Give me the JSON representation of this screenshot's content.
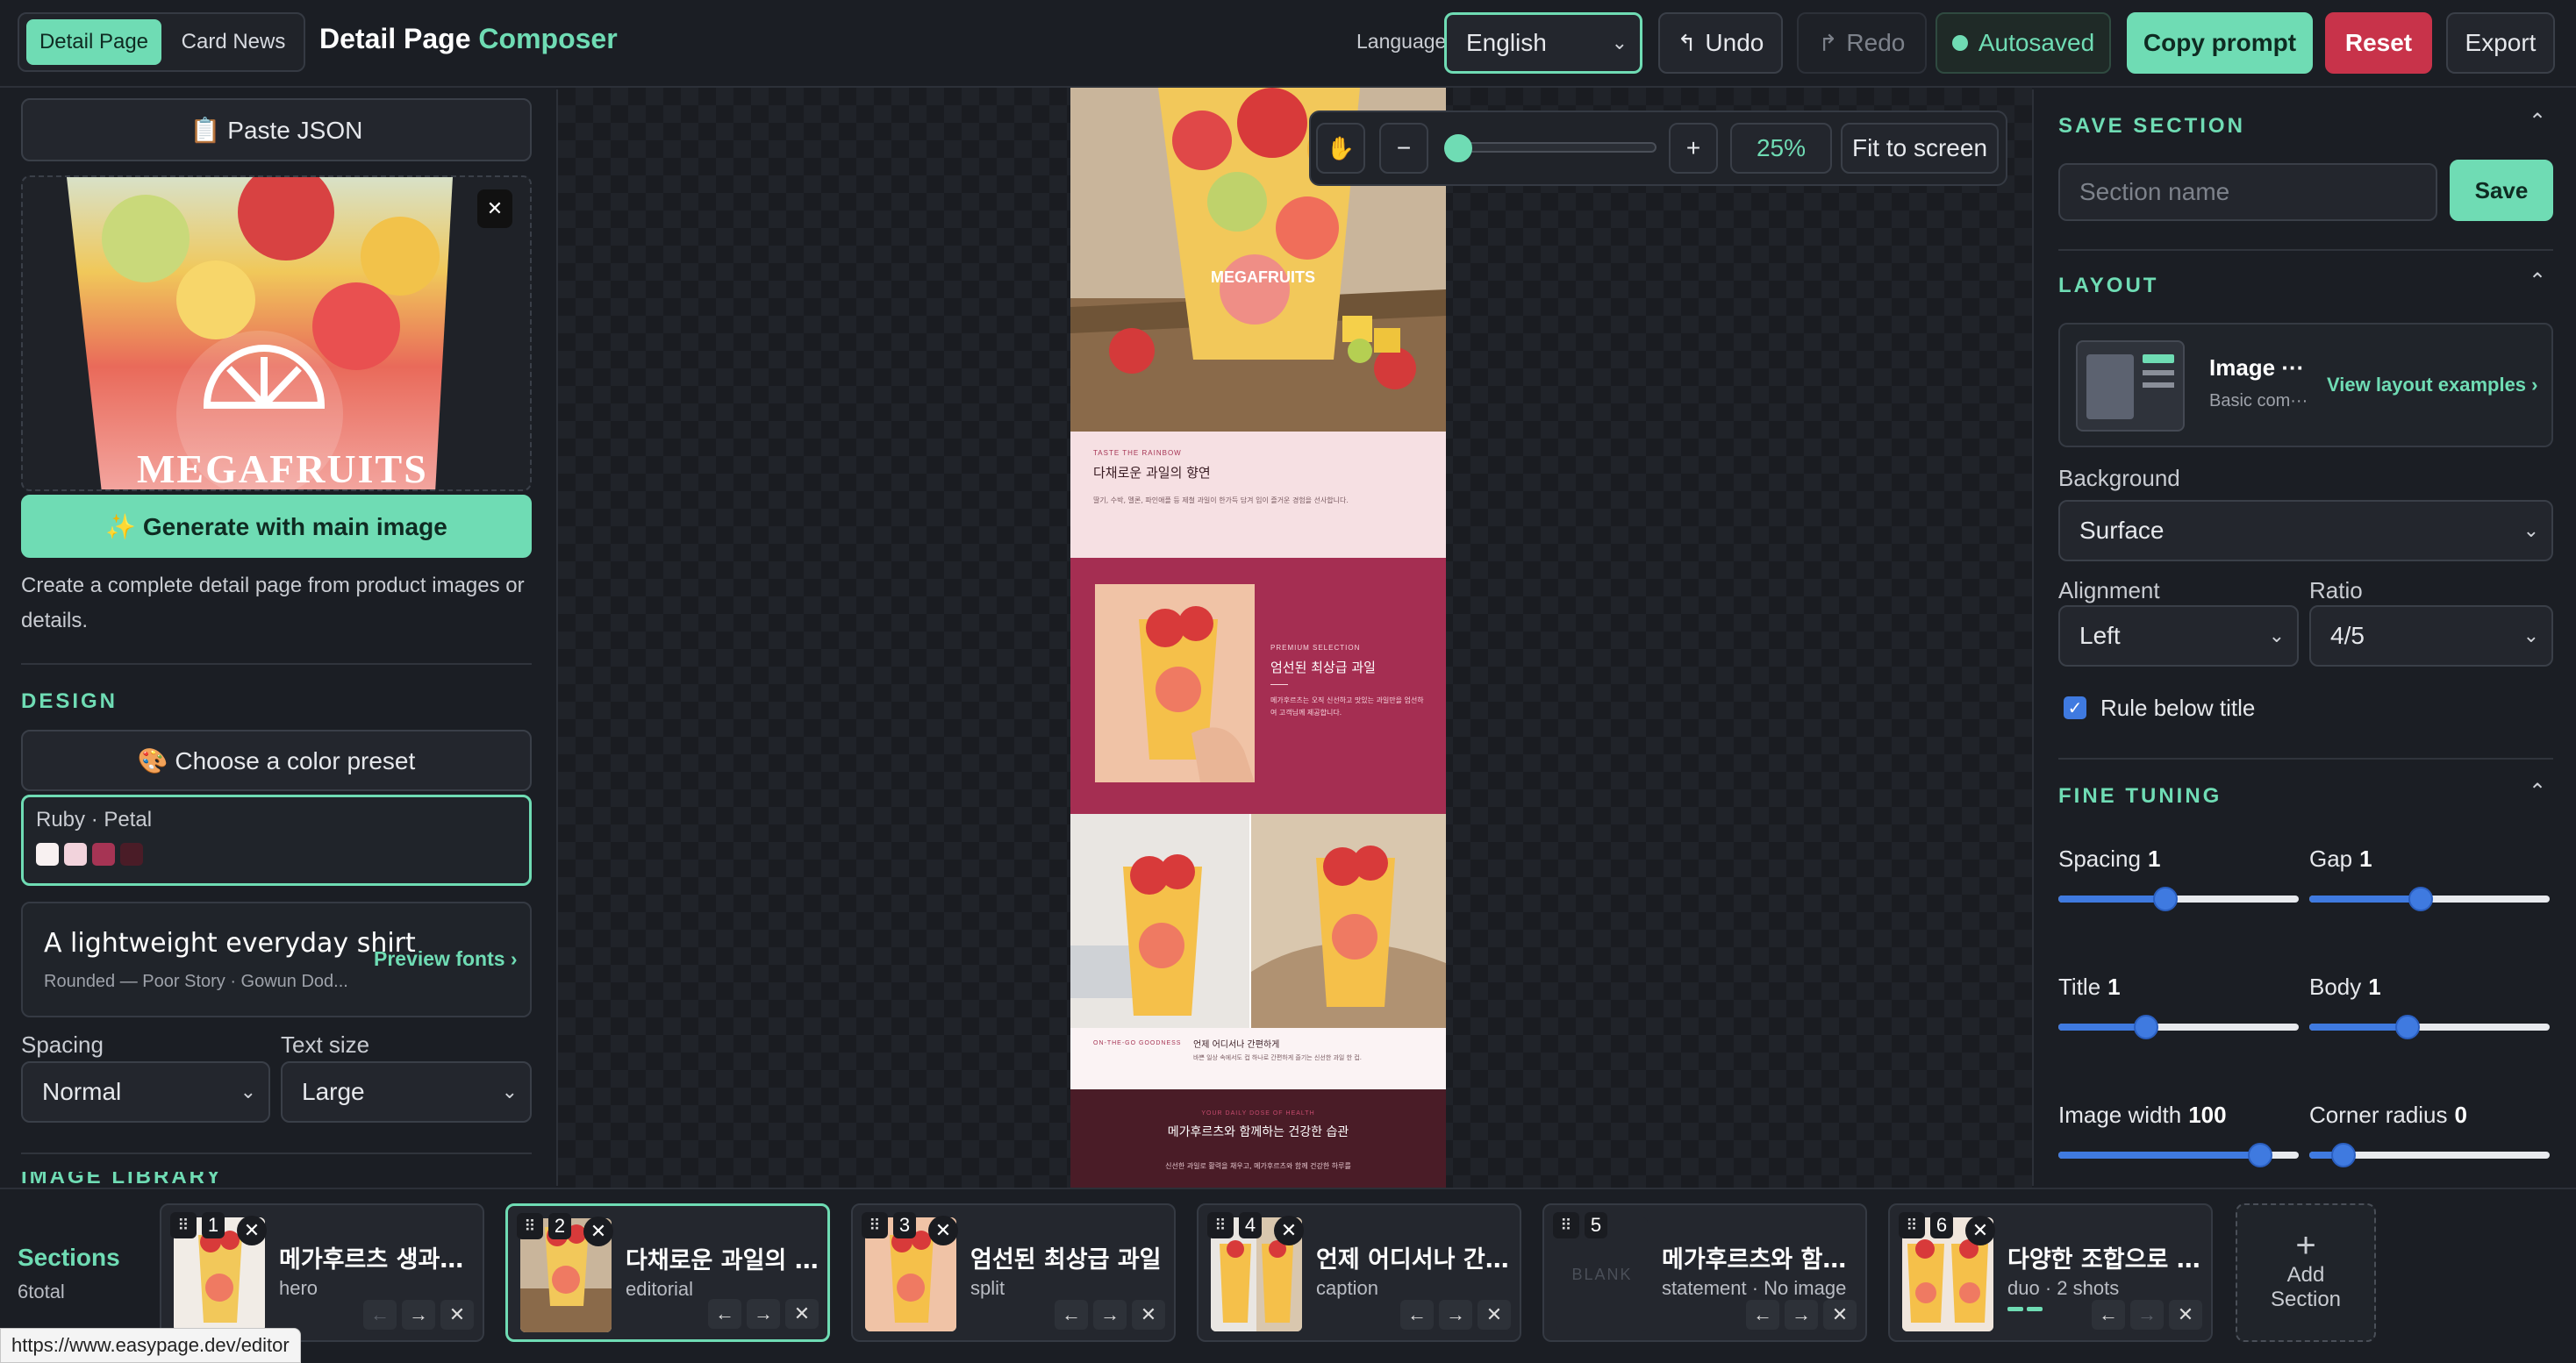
{
  "header": {
    "mode_tabs": [
      {
        "label": "Detail Page",
        "active": true
      },
      {
        "label": "Card News",
        "active": false
      }
    ],
    "title_part1": "Detail Page",
    "title_part2": "Composer",
    "language_label": "Language",
    "language_value": "English",
    "undo_label": "Undo",
    "redo_label": "Redo",
    "autosaved_label": "Autosaved",
    "copy_prompt_label": "Copy prompt",
    "reset_label": "Reset",
    "export_label": "Export"
  },
  "left_panel": {
    "paste_json_label": "📋 Paste JSON",
    "preview_brand": "MEGAFRUITS",
    "generate_label": "✨ Generate with main image",
    "generate_desc": "Create a complete detail page from product images or details.",
    "design_heading": "DESIGN",
    "color_preset_label": "🎨 Choose a color preset",
    "palette_name": "Ruby · Petal",
    "palette_colors": [
      "#f8f1f1",
      "#f2d3dc",
      "#a63454",
      "#4a1c27"
    ],
    "font_sample": "A lightweight everyday shirt",
    "font_desc": "Rounded — Poor Story · Gowun Dod...",
    "preview_fonts_label": "Preview fonts ›",
    "spacing_label": "Spacing",
    "spacing_value": "Normal",
    "text_size_label": "Text size",
    "text_size_value": "Large",
    "next_heading": "IMAGE LIBRARY"
  },
  "canvas": {
    "zoom_value": "25%",
    "zoom_fraction": 0.0,
    "fit_label": "Fit to screen",
    "hero_brand": "MEGAFRUITS",
    "s2_eyebrow": "TASTE THE RAINBOW",
    "s2_title": "다채로운 과일의 향연",
    "s2_body": "딸기, 수박, 멜론, 파인애플 등 제철 과일이 한가득 담겨 입이 즐거운 경험을 선사합니다.",
    "s3_eyebrow": "PREMIUM SELECTION",
    "s3_title": "엄선된 최상급 과일",
    "s3_body": "메가후르츠는 오직 신선하고 맛있는 과일만을 엄선하여 고객님께 제공합니다.",
    "s4_eyebrow": "ON-THE-GO GOODNESS",
    "s4_title": "언제 어디서나 간편하게",
    "s4_body": "바쁜 일상 속에서도 컵 하나로 간편하게 즐기는 신선한 과일 한 컵.",
    "s5_eyebrow": "YOUR DAILY DOSE OF HEALTH",
    "s5_title": "메가후르츠와 함께하는 건강한 습관",
    "s5_body": "신선한 과일로 활력을 채우고, 메가후르츠와 함께 건강한 하루를"
  },
  "right_panel": {
    "save_heading": "SAVE SECTION",
    "section_name_placeholder": "Section name",
    "save_label": "Save",
    "layout_heading": "LAYOUT",
    "layout_name": "Image ···",
    "layout_desc": "Basic com···",
    "view_examples_label": "View layout examples ›",
    "background_label": "Background",
    "background_value": "Surface",
    "alignment_label": "Alignment",
    "alignment_value": "Left",
    "ratio_label": "Ratio",
    "ratio_value": "4/5",
    "rule_label": "Rule below title",
    "rule_checked": true,
    "fine_heading": "FINE TUNING",
    "sliders": [
      {
        "label": "Spacing",
        "value": "1",
        "fraction": 0.44
      },
      {
        "label": "Gap",
        "value": "1",
        "fraction": 0.46
      },
      {
        "label": "Title",
        "value": "1",
        "fraction": 0.35
      },
      {
        "label": "Body",
        "value": "1",
        "fraction": 0.4
      },
      {
        "label": "Image width",
        "value": "100",
        "fraction": 0.88
      },
      {
        "label": "Corner radius",
        "value": "0",
        "fraction": 0.1
      }
    ]
  },
  "sections_bar": {
    "title": "Sections",
    "count": "6total",
    "add_label_1": "Add",
    "add_label_2": "Section",
    "cards": [
      {
        "num": "1",
        "title": "메가후르츠 생과일컵",
        "sub": "hero"
      },
      {
        "num": "2",
        "title": "다채로운 과일의 향연",
        "sub": "editorial"
      },
      {
        "num": "3",
        "title": "엄선된 최상급 과일",
        "sub": "split"
      },
      {
        "num": "4",
        "title": "언제 어디서나 간편···",
        "sub": "caption"
      },
      {
        "num": "5",
        "title": "메가후르츠와 함께···",
        "sub": "statement · No image",
        "blank": "BLANK"
      },
      {
        "num": "6",
        "title": "다양한 조합으로 즐···",
        "sub": "duo · 2 shots"
      }
    ]
  },
  "status_url": "https://www.easypage.dev/editor"
}
